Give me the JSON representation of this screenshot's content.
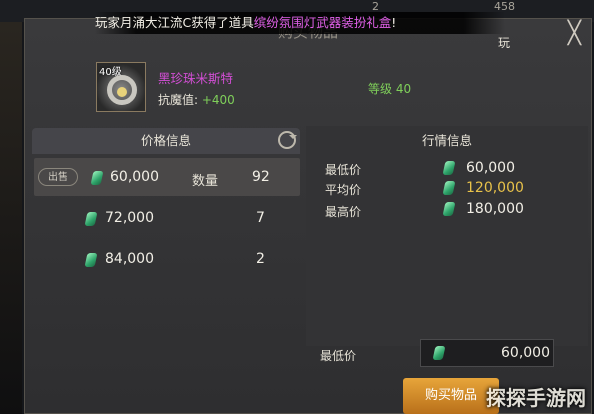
{
  "background": {
    "top_value_1": "2",
    "top_value_2": "458"
  },
  "dialog": {
    "title": "购买物品",
    "close_glyph": "╳"
  },
  "ticker": {
    "prefix": "玩家月涌大江流C获得了道具",
    "item": "缤纷氛围灯武器装扮礼盒",
    "suffix": "!",
    "tail": "玩"
  },
  "item": {
    "level_badge": "40级",
    "name": "黑珍珠米斯特",
    "stat_label": "抗魔值: ",
    "stat_value": "+400",
    "level_text": "等级 40"
  },
  "price_panel": {
    "header": "价格信息",
    "sell_badge": "出售",
    "qty_label": "数量",
    "rows": [
      {
        "price": "60,000",
        "qty": "92"
      },
      {
        "price": "72,000",
        "qty": "7"
      },
      {
        "price": "84,000",
        "qty": "2"
      }
    ]
  },
  "market_panel": {
    "header": "行情信息",
    "rows": [
      {
        "label": "最低价",
        "value": "60,000"
      },
      {
        "label": "平均价",
        "value": "120,000"
      },
      {
        "label": "最高价",
        "value": "180,000"
      }
    ]
  },
  "purchase": {
    "min_label": "最低价",
    "min_value": "60,000",
    "buy_label": "购买物品"
  },
  "watermark": "探探手游网",
  "colors": {
    "accent_gold": "#e8c24a",
    "purple_item": "#d24ed4",
    "green_stat": "#7fcf5a",
    "button": "#d08a2a"
  }
}
